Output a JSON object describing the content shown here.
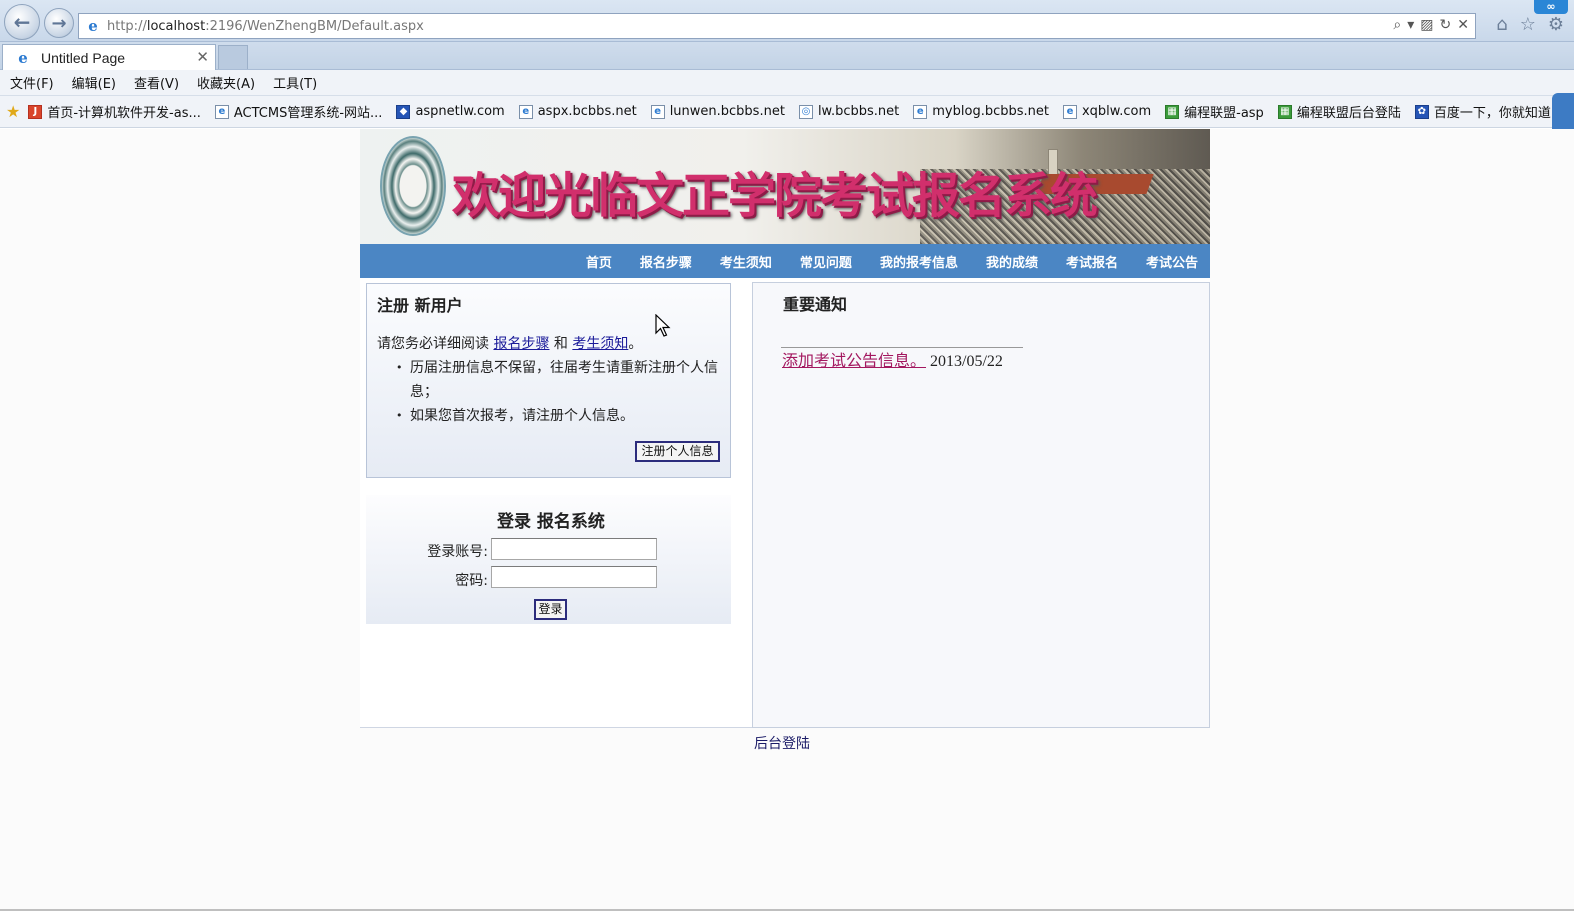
{
  "browser": {
    "url": "http://localhost:2196/WenZhengBM/Default.aspx",
    "url_host": "localhost",
    "url_prefix": "http://",
    "url_rest": ":2196/WenZhengBM/Default.aspx",
    "tab_title": "Untitled Page",
    "tab_close": "✕",
    "corner_badge": "∞",
    "menu": [
      "文件(F)",
      "编辑(E)",
      "查看(V)",
      "收藏夹(A)",
      "工具(T)"
    ],
    "favorites": [
      {
        "label": "首页-计算机软件开发-as...",
        "icon": "red"
      },
      {
        "label": "ACTCMS管理系统-网站...",
        "icon": "page"
      },
      {
        "label": "aspnetlw.com",
        "icon": "blue"
      },
      {
        "label": "aspx.bcbbs.net",
        "icon": "page"
      },
      {
        "label": "lunwen.bcbbs.net",
        "icon": "page"
      },
      {
        "label": "lw.bcbbs.net",
        "icon": "page"
      },
      {
        "label": "myblog.bcbbs.net",
        "icon": "page"
      },
      {
        "label": "xqblw.com",
        "icon": "page"
      },
      {
        "label": "编程联盟-asp",
        "icon": "green"
      },
      {
        "label": "编程联盟后台登陆",
        "icon": "green"
      },
      {
        "label": "百度一下，你就知道",
        "icon": "blue"
      }
    ]
  },
  "banner": {
    "title": "欢迎光临文正学院考试报名系统"
  },
  "nav": [
    "首页",
    "报名步骤",
    "考生须知",
    "常见问题",
    "我的报考信息",
    "我的成绩",
    "考试报名",
    "考试公告"
  ],
  "register": {
    "heading": "注册 新用户",
    "intro_prefix": "请您务必详细阅读 ",
    "link_steps": "报名步骤",
    "intro_and": " 和 ",
    "link_notice": "考生须知",
    "intro_suffix": "。",
    "items": [
      "历届注册信息不保留，往届考生请重新注册个人信息；",
      "如果您首次报考，请注册个人信息。"
    ],
    "button": "注册个人信息"
  },
  "login": {
    "heading": "登录 报名系统",
    "account_label": "登录账号:",
    "password_label": "密码:",
    "account_value": "",
    "password_value": "",
    "button": "登录"
  },
  "notice": {
    "heading": "重要通知",
    "items": [
      {
        "title": "添加考试公告信息。",
        "date": "2013/05/22"
      }
    ]
  },
  "footer": {
    "admin_link": "后台登陆"
  },
  "colors": {
    "nav_bar": "#4b86c4",
    "banner_title": "#d12f6c",
    "notice_link": "#a3175f"
  }
}
